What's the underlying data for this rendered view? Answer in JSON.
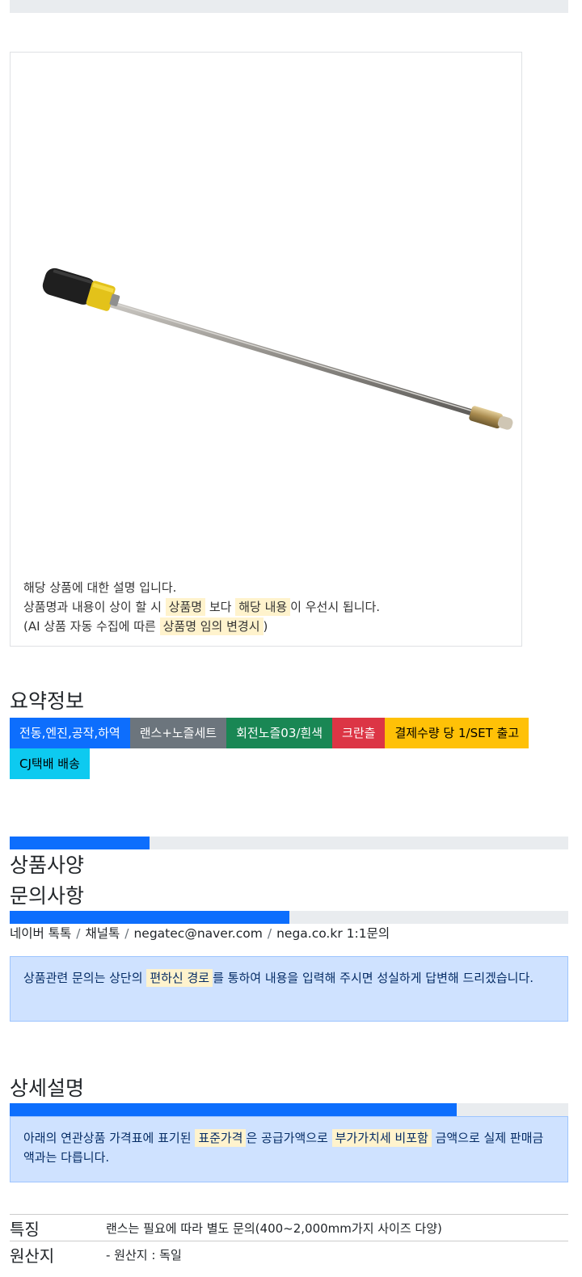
{
  "product": {
    "image_alt": "lance-nozzle-product",
    "desc_line1": "해당 상품에 대한 설명 입니다.",
    "desc_line2_a": "상품명과 내용이 상이 할 시 ",
    "desc_line2_hl1": "상품명",
    "desc_line2_b": " 보다 ",
    "desc_line2_hl2": "해당 내용",
    "desc_line2_c": "이 우선시 됩니다.",
    "desc_line3_a": "(AI 상품 자동 수집에 따른 ",
    "desc_line3_hl": "상품명 임의 변경시",
    "desc_line3_b": ")"
  },
  "summary": {
    "title": "요약정보",
    "badges": [
      {
        "label": "전동,엔진,공작,하역",
        "color": "#0d6efd",
        "text": "#ffffff"
      },
      {
        "label": "랜스+노즐세트",
        "color": "#6c757d",
        "text": "#ffffff"
      },
      {
        "label": "회전노즐03/흰색",
        "color": "#198754",
        "text": "#ffffff"
      },
      {
        "label": "크란츨",
        "color": "#dc3545",
        "text": "#ffffff"
      },
      {
        "label": "결제수량 당 1/SET 출고",
        "color": "#ffc107",
        "text": "#000000"
      },
      {
        "label": "CJ택배 배송",
        "color": "#0dcaf0",
        "text": "#000000"
      }
    ]
  },
  "progress": {
    "spec_fill": 0.25,
    "inquiry_fill": 0.5,
    "detail_fill": 0.8
  },
  "spec_section": {
    "title": "상품사양"
  },
  "inquiry": {
    "title": "문의사항",
    "contacts": [
      "네이버 톡톡",
      "채널톡",
      "negatec@naver.com",
      "nega.co.kr 1:1문의"
    ],
    "separator": "/",
    "notice_a": "상품관련 문의는 상단의 ",
    "notice_hl": "편하신 경로",
    "notice_b": "를 통하여 내용을 입력해 주시면 성실하게 답변해 드리겠습니다."
  },
  "detail": {
    "title": "상세설명",
    "notice_a": "아래의 연관상품 가격표에 표기된 ",
    "notice_hl1": "표준가격",
    "notice_b": "은 공급가액으로 ",
    "notice_hl2": "부가가치세 비포함",
    "notice_c": " 금액으로 실제 판매금액과는 다릅니다.",
    "rows": [
      {
        "key": "특징",
        "value": "랜스는 필요에 따라 별도 문의(400~2,000mm가지 사이즈 다양)"
      },
      {
        "key": "원산지",
        "value": "- 원산지 : 독일"
      }
    ]
  }
}
